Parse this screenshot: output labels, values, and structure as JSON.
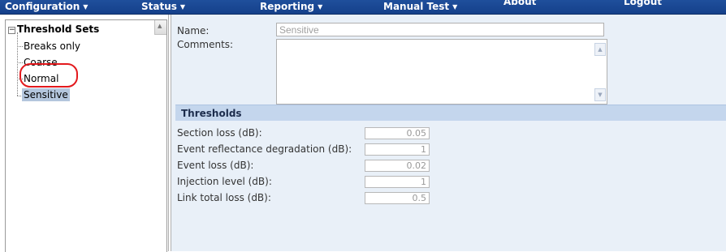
{
  "menu": {
    "configuration": "Configuration",
    "status": "Status",
    "reporting": "Reporting",
    "manual_test": "Manual Test",
    "about": "About",
    "logout": "Logout",
    "dropdown_glyph": "▼"
  },
  "tree": {
    "root_label": "Threshold Sets",
    "items": [
      "Breaks only",
      "Coarse",
      "Normal",
      "Sensitive"
    ],
    "selected": "Sensitive"
  },
  "form": {
    "name_label": "Name:",
    "name_value": "Sensitive",
    "comments_label": "Comments:",
    "comments_value": ""
  },
  "thresholds": {
    "header": "Thresholds",
    "rows": [
      {
        "label": "Section loss (dB):",
        "value": "0.05"
      },
      {
        "label": "Event reflectance degradation (dB):",
        "value": "1"
      },
      {
        "label": "Event loss (dB):",
        "value": "0.02"
      },
      {
        "label": "Injection level (dB):",
        "value": "1"
      },
      {
        "label": "Link total loss (dB):",
        "value": "0.5"
      }
    ]
  },
  "colors": {
    "menubar": "#1a4891",
    "panel_background": "#e9f0f8",
    "section_header": "#c4d6ed",
    "selection": "#b4c6dd",
    "highlight_ring": "#e3191d"
  }
}
